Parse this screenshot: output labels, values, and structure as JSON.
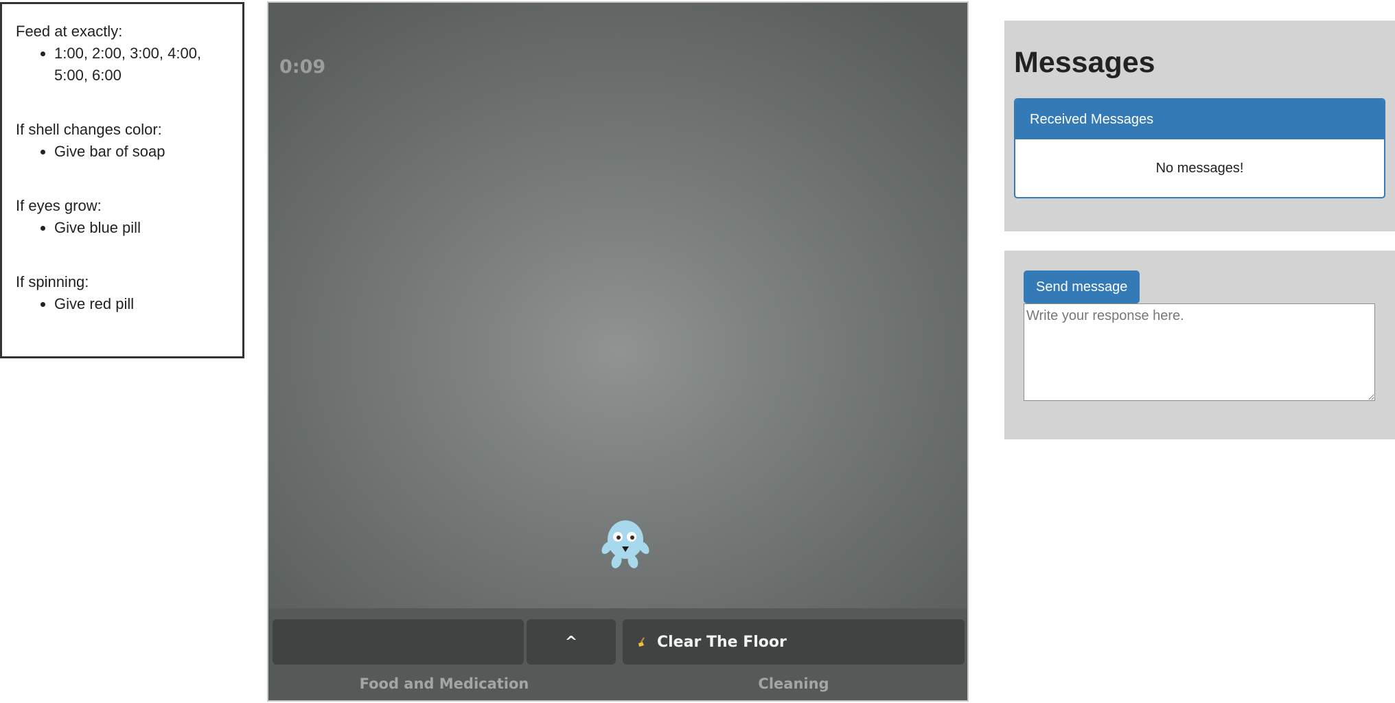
{
  "instructions": {
    "rules": [
      {
        "condition": "Feed at exactly:",
        "actions": [
          "1:00, 2:00, 3:00, 4:00, 5:00, 6:00"
        ]
      },
      {
        "condition": "If shell changes color:",
        "actions": [
          "Give bar of soap"
        ]
      },
      {
        "condition": "If eyes grow:",
        "actions": [
          "Give blue pill"
        ]
      },
      {
        "condition": "If spinning:",
        "actions": [
          "Give red pill"
        ]
      }
    ]
  },
  "game": {
    "timer": "0:09",
    "caret_button": "^",
    "clear_floor_button": "Clear The Floor",
    "categories": {
      "food": "Food and Medication",
      "cleaning": "Cleaning"
    },
    "creature": "blue-creature",
    "colors": {
      "creature": "#a8d8ec",
      "control_bar": "#555a59",
      "button": "#3f4443"
    }
  },
  "messages": {
    "title": "Messages",
    "received_header": "Received Messages",
    "empty_text": "No messages!",
    "send_button": "Send message",
    "reply_placeholder": "Write your response here.",
    "reply_value": "",
    "accent": "#337ab7"
  }
}
